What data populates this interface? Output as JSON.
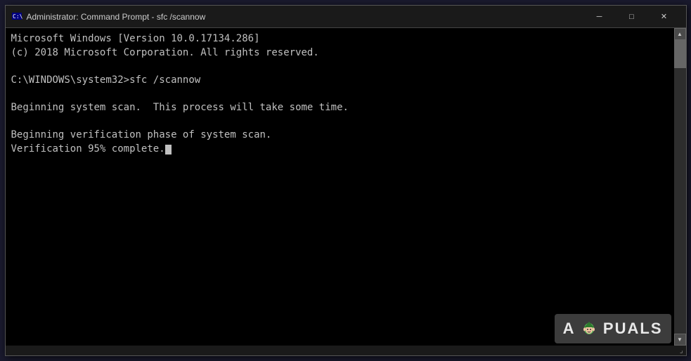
{
  "window": {
    "title": "Administrator: Command Prompt - sfc /scannow",
    "icon": "cmd-icon"
  },
  "controls": {
    "minimize": "─",
    "maximize": "□",
    "close": "✕"
  },
  "terminal": {
    "lines": [
      "Microsoft Windows [Version 10.0.17134.286]",
      "(c) 2018 Microsoft Corporation. All rights reserved.",
      "",
      "C:\\WINDOWS\\system32>sfc /scannow",
      "",
      "Beginning system scan.  This process will take some time.",
      "",
      "Beginning verification phase of system scan.",
      "Verification 95% complete."
    ]
  },
  "watermark": {
    "text": "APPUALS"
  }
}
